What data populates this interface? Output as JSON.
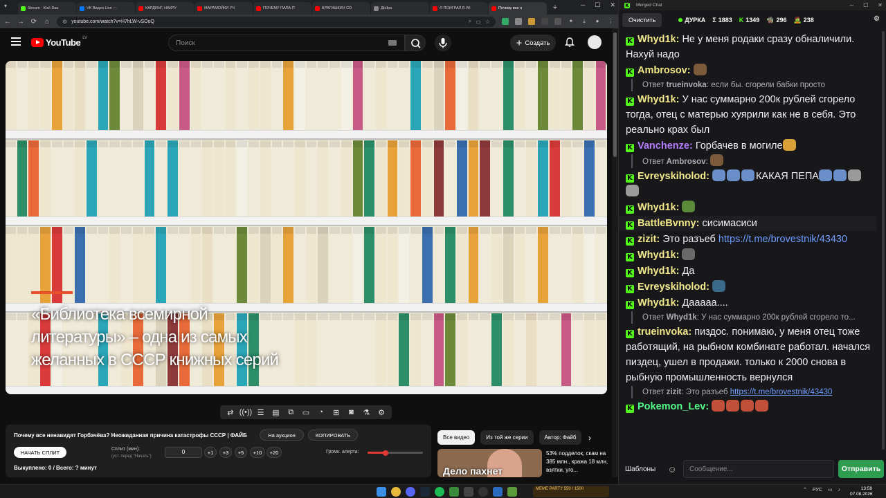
{
  "browser": {
    "tabs": [
      {
        "label": "Stream - Kick Das",
        "color": "#53fc18",
        "active": false
      },
      {
        "label": "VK Видео Live —",
        "color": "#0077ff",
        "active": false
      },
      {
        "label": "КАРДИНГ, НАКРУ",
        "color": "#ff0000",
        "active": false
      },
      {
        "label": "МАРАМОЙКИ УЧ",
        "color": "#ff0000",
        "active": false
      },
      {
        "label": "ПОЧЕМУ ПАПА П",
        "color": "#ff0000",
        "active": false
      },
      {
        "label": "БРАТИШКИН СО",
        "color": "#ff0000",
        "active": false
      },
      {
        "label": "ДЫIpa",
        "color": "#888888",
        "active": false
      },
      {
        "label": "Я ПОИГРАЛ В Wi",
        "color": "#ff0000",
        "active": false
      },
      {
        "label": "Почему все н",
        "color": "#ff0000",
        "active": true
      }
    ],
    "new_tab": "+",
    "url": "youtube.com/watch?v=H7hLW-vSOoQ"
  },
  "youtube": {
    "logo_text": "YouTube",
    "country_code": "LV",
    "search_placeholder": "Поиск",
    "create_label": "Создать",
    "video": {
      "caption": "«Библиотека всемирной литературы» – одна из самых желанных в СССР книжных серий",
      "bar_color": "#e8522a"
    },
    "panel": {
      "title": "Почему все ненавидят Горбачёва? Неожиданная причина катастрофы СССР | ФАЙБ",
      "auction_button": "На аукцион",
      "copy_button": "КОПИРОВАТЬ",
      "split_button": "НАЧАТЬ СПЛИТ",
      "split_label": "Сплит (мин):",
      "split_hint": "(уст. перед \"Начать\")",
      "split_value": "0",
      "increments": [
        "+1",
        "+3",
        "+5",
        "+10",
        "+20"
      ],
      "volume_label": "Громк. алерта:",
      "volume_level": 0.33,
      "footer": "Выкуплено: 0 / Всего: ? минут"
    },
    "chips": [
      "Все видео",
      "Из той же серии",
      "Автор: Файб"
    ],
    "recommendation": {
      "thumb_text": "Дело пахнет",
      "title": "53% подделок, скам на 385 млн., кража 18 млн, взятки, уго..."
    }
  },
  "chat": {
    "window_title": "Merged Chat",
    "clear_button": "Очистить",
    "channel": "ДУРКА",
    "stats": [
      {
        "icon": "Σ",
        "value": "1883",
        "color": "#ffffff"
      },
      {
        "icon": "K",
        "value": "1349",
        "color": "#53fc18"
      },
      {
        "icon": "🧌",
        "value": "296",
        "color": "#c8a060"
      },
      {
        "icon": "🧟",
        "value": "238",
        "color": "#9acd32"
      }
    ],
    "messages": [
      {
        "type": "msg",
        "user": "Whyd1k",
        "color": "#f2e88a",
        "text": "Не у меня родаки сразу обналичили. Нахуй надо"
      },
      {
        "type": "msg",
        "user": "Ambrosov",
        "color": "#f2e88a",
        "text": "",
        "emotes": [
          "#7a5a3a"
        ]
      },
      {
        "type": "reply",
        "user": "trueinvoka",
        "text": "если бы. сгорели бабки просто"
      },
      {
        "type": "msg",
        "user": "Whyd1k",
        "color": "#f2e88a",
        "text": "У нас суммарно 200к рублей сгорело тогда, отец с матерью хуярили как не в себя. Это реально крах был"
      },
      {
        "type": "msg",
        "user": "Vanchenze",
        "color": "#b57cff",
        "text": "Горбачев в могиле",
        "emotes": [
          "#d9a03a"
        ]
      },
      {
        "type": "reply",
        "user": "Ambrosov",
        "text": "",
        "emotes": [
          "#7a5a3a"
        ]
      },
      {
        "type": "msg",
        "user": "Evreyskiholod",
        "color": "#f2e88a",
        "text": "",
        "pre_emotes": [
          "#6a8fc8",
          "#6a8fc8",
          "#6a8fc8"
        ],
        "mid": "КАКАЯ ПЕПА",
        "post_emotes": [
          "#6a8fc8",
          "#6a8fc8",
          "#9a9a9a",
          "#9a9a9a"
        ]
      },
      {
        "type": "msg",
        "user": "Whyd1k",
        "color": "#f2e88a",
        "text": "",
        "emotes": [
          "#5a8a3a"
        ]
      },
      {
        "type": "msg",
        "user": "BattleBvnny",
        "color": "#f2e88a",
        "text": "сисимасиси",
        "highlight": true
      },
      {
        "type": "msg",
        "user": "zizit",
        "color": "#f2e88a",
        "text": "Это разъеб ",
        "link": "https://t.me/brovestnik/43430"
      },
      {
        "type": "msg",
        "user": "Whyd1k",
        "color": "#f2e88a",
        "text": "",
        "emotes": [
          "#6a6a6a"
        ]
      },
      {
        "type": "msg",
        "user": "Whyd1k",
        "color": "#f2e88a",
        "text": "Да"
      },
      {
        "type": "msg",
        "user": "Evreyskiholod",
        "color": "#f2e88a",
        "text": "",
        "emotes": [
          "#3a6a8a"
        ]
      },
      {
        "type": "msg",
        "user": "Whyd1k",
        "color": "#f2e88a",
        "text": "Дааааа...."
      },
      {
        "type": "reply",
        "user": "Whyd1k",
        "text": "У нас суммарно 200к рублей сгорело то..."
      },
      {
        "type": "msg",
        "user": "trueinvoka",
        "color": "#f2e88a",
        "text": "пиздос. понимаю, у меня отец тоже работящий, на рыбном комбинате работал. начался пиздец, ушел в продажи. только к 2000 снова в рыбную промышленность вернулся"
      },
      {
        "type": "reply",
        "user": "zizit",
        "text": "Это разъеб ",
        "link": "https://t.me/brovestnik/43430"
      },
      {
        "type": "msg",
        "user": "Pokemon_Lev",
        "color": "#53fc8a",
        "text": "",
        "emotes": [
          "#c0503a",
          "#c0503a",
          "#c0503a",
          "#c0503a"
        ]
      }
    ],
    "templates_button": "Шаблоны",
    "input_placeholder": "Сообщение...",
    "send_button": "Отправить"
  },
  "taskbar": {
    "widget_text": "MEME PARTY 550 / 1500",
    "lang": "РУС",
    "time": "13:58",
    "date": "07.08.2026"
  }
}
